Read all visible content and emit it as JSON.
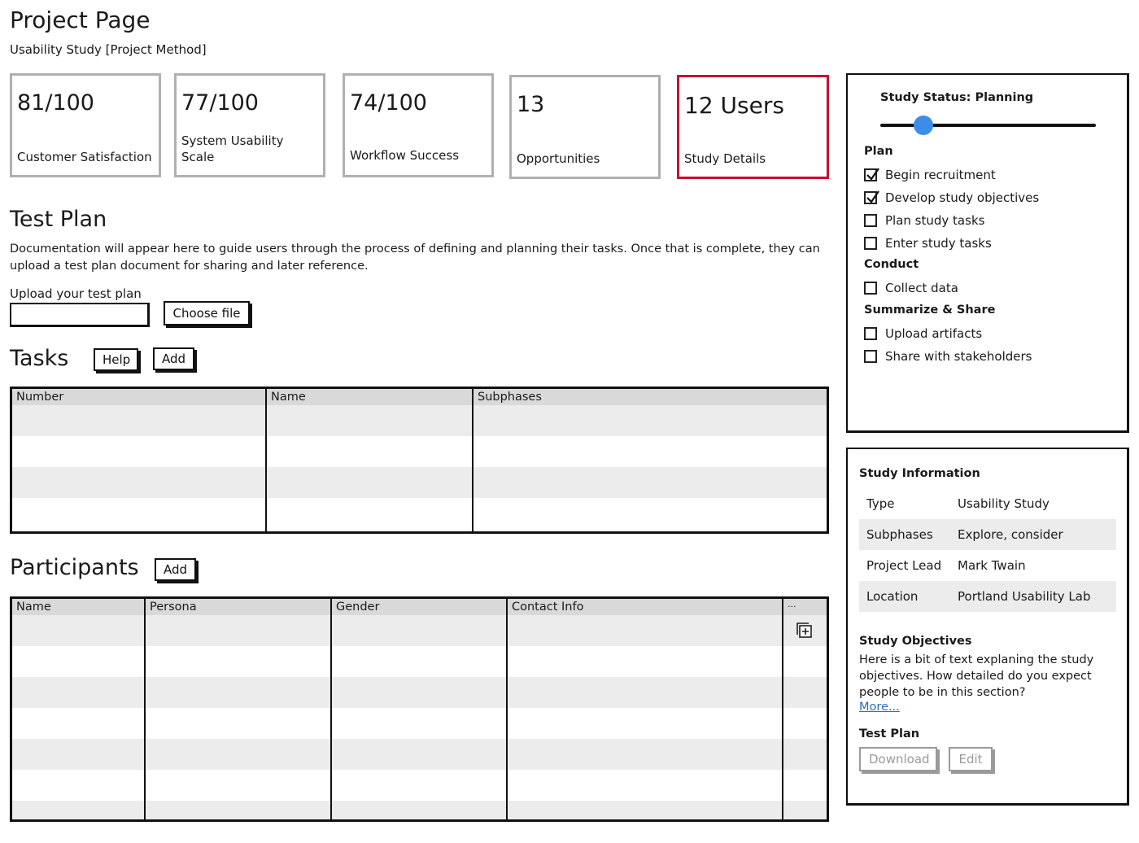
{
  "page": {
    "title": "Project Page",
    "subtitle": "Usability Study [Project Method]"
  },
  "metrics": [
    {
      "value": "81/100",
      "label": "Customer Satisfaction"
    },
    {
      "value": "77/100",
      "label": "System Usability Scale"
    },
    {
      "value": "74/100",
      "label": "Workflow Success"
    },
    {
      "value": "13",
      "label": "Opportunities"
    },
    {
      "value": "12 Users",
      "label": "Study Details"
    }
  ],
  "test_plan": {
    "title": "Test Plan",
    "description": "Documentation will appear here to guide users through the process of defining and planning their tasks. Once that is complete, they can upload a test plan document for sharing and later reference.",
    "upload_label": "Upload your test plan",
    "upload_value": "",
    "choose_file_label": "Choose file"
  },
  "tasks": {
    "title": "Tasks",
    "help_label": "Help",
    "add_label": "Add",
    "columns": [
      "Number",
      "Name",
      "Subphases"
    ]
  },
  "participants": {
    "title": "Participants",
    "add_label": "Add",
    "columns": [
      "Name",
      "Persona",
      "Gender",
      "Contact Info",
      "..."
    ],
    "add_icon": "add-square-icon"
  },
  "study_status": {
    "label": "Study Status: Planning",
    "slider_position": 0.2,
    "groups": [
      {
        "label": "Plan",
        "items": [
          {
            "label": "Begin recruitment",
            "checked": true
          },
          {
            "label": "Develop study objectives",
            "checked": true
          },
          {
            "label": "Plan study tasks",
            "checked": false
          },
          {
            "label": "Enter study tasks",
            "checked": false
          }
        ]
      },
      {
        "label": "Conduct",
        "items": [
          {
            "label": "Collect data",
            "checked": false
          }
        ]
      },
      {
        "label": "Summarize & Share",
        "items": [
          {
            "label": "Upload artifacts",
            "checked": false
          },
          {
            "label": "Share with stakeholders",
            "checked": false
          }
        ]
      }
    ]
  },
  "study_info": {
    "title": "Study Information",
    "rows": [
      {
        "key": "Type",
        "value": "Usability Study"
      },
      {
        "key": "Subphases",
        "value": "Explore, consider"
      },
      {
        "key": "Project Lead",
        "value": "Mark Twain"
      },
      {
        "key": "Location",
        "value": "Portland Usability Lab"
      }
    ],
    "objectives_title": "Study Objectives",
    "objectives_text": "Here is a bit of text explaning the study objectives. How detailed do you expect people to be in this section?",
    "more_link": "More...",
    "test_plan_title": "Test Plan",
    "download_label": "Download",
    "edit_label": "Edit"
  },
  "colors": {
    "accent": "#3a8ee8",
    "selected_border": "#c8102e",
    "link": "#2a6dc0"
  }
}
